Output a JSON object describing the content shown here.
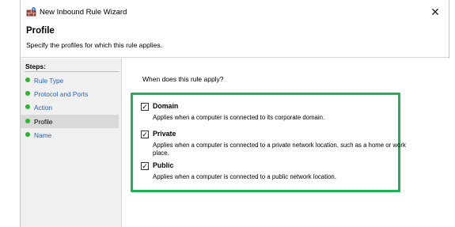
{
  "window": {
    "title": "New Inbound Rule Wizard",
    "close_glyph": "✕"
  },
  "header": {
    "title": "Profile",
    "subtitle": "Specify the profiles for which this rule applies."
  },
  "sidebar": {
    "title": "Steps:",
    "items": [
      {
        "label": "Rule Type",
        "state": "link"
      },
      {
        "label": "Protocol and Ports",
        "state": "link"
      },
      {
        "label": "Action",
        "state": "link"
      },
      {
        "label": "Profile",
        "state": "current"
      },
      {
        "label": "Name",
        "state": "link"
      }
    ]
  },
  "main": {
    "question": "When does this rule apply?",
    "options": [
      {
        "label": "Domain",
        "checked": true,
        "description": "Applies when a computer is connected to its corporate domain."
      },
      {
        "label": "Private",
        "checked": true,
        "description": "Applies when a computer is connected to a private network location, such as a home or work place."
      },
      {
        "label": "Public",
        "checked": true,
        "description": "Applies when a computer is connected to a public network location."
      }
    ],
    "check_glyph": "✓"
  },
  "colors": {
    "highlight_border": "#1fb254",
    "step_link": "#2a63b5",
    "step_dot": "#2db52d",
    "sidebar_bg": "#f0f0f0"
  },
  "icons": {
    "app": "firewall-icon",
    "step": "green-dot-icon",
    "close": "close-icon"
  }
}
